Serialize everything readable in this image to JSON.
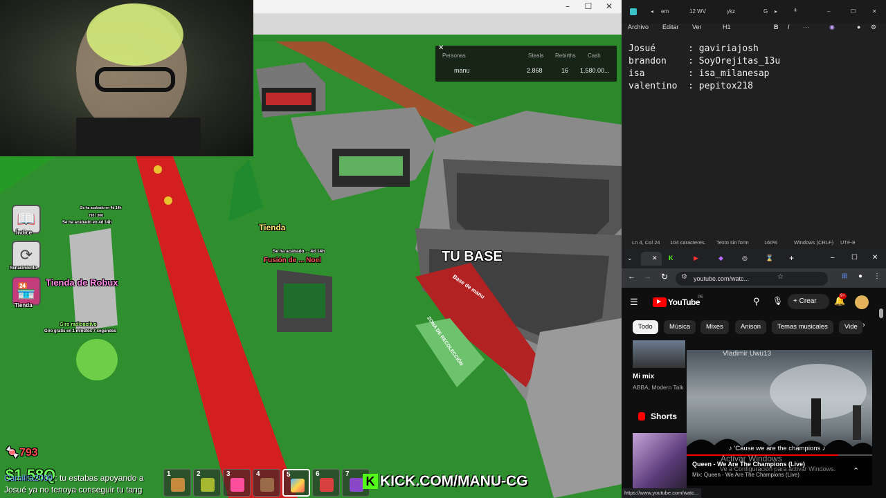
{
  "game": {
    "leaderboard": {
      "headers": [
        "Personas",
        "Steals",
        "Rebirths",
        "Cash"
      ],
      "row": {
        "name": "manu",
        "steals": "2.868",
        "rebirths": "16",
        "cash": "1.580.00..."
      }
    },
    "labels": {
      "tu_base": "TU BASE",
      "base_de_manu": "Base de manu",
      "zona": "ZONA DE RECOLECCIÓN",
      "tienda": "Tienda",
      "fusion": "Fusión de ... Noel",
      "se_ha_acabado_1": "Se ha acabado en 4d 14h",
      "se_ha_acabado_2": "Se ha acabado en 4d 14h",
      "se_ha_acabado_3": "Se ha acabado ... 4d 14h",
      "counter_small": "793 / 300",
      "tienda_robux": "Tienda de Robux",
      "giro": "Giro radioactivo",
      "giro_sub": "Giro gratis en 1 minutos 7 segundos",
      "candy_count": "793",
      "cash_partial": "$1.58Q",
      "kick": "KICK.COM/MANU-CG"
    },
    "side_buttons": [
      {
        "label": "Índice",
        "icon": "book-icon"
      },
      {
        "label": "Renacimiento",
        "icon": "refresh-icon"
      },
      {
        "label": "Tienda",
        "icon": "shop-icon"
      }
    ],
    "hotbar": [
      "1",
      "2",
      "3",
      "4",
      "5",
      "6",
      "7"
    ],
    "chat": [
      {
        "user": "Camilita2009",
        "text": ": tu estabas apoyando a"
      },
      {
        "user": "",
        "text": "Josué ya no tenoya conseguir tu tang"
      }
    ],
    "window_controls": [
      "–",
      "☐",
      "✕"
    ]
  },
  "editor": {
    "tabs": [
      "em",
      "12 WV",
      "ykz",
      "G"
    ],
    "menu": [
      "Archivo",
      "Editar",
      "Ver",
      "H1"
    ],
    "content": "Josué      : gaviriajosh\nbrandon    : SoyOrejitas_13u\nisa        : isa_milanesap\nvalentino  : pepitox218",
    "status": [
      "Ln 4, Col 24",
      "104 caracteres.",
      "Texto sin form",
      "160%",
      "Windows (CRLF)",
      "UTF-8"
    ]
  },
  "browser": {
    "url": "youtube.com/watc...",
    "yt_logo": "YouTube",
    "yt_region": "PE",
    "create": "Crear",
    "notif_count": "9+",
    "chips": [
      "Todo",
      "Música",
      "Mixes",
      "Anison",
      "Temas musicales",
      "Vide"
    ],
    "mix_title": "Mi mix",
    "mix_sub": "ABBA, Modern Talk",
    "shorts": "Shorts",
    "mini_title_top": "Vladimir Uwu13",
    "caption": "♪ 'Cause we are the champions ♪",
    "activate": "Activar Windows",
    "activate_sub": "Ve a Configuración para activar Windows.",
    "now_title": "Queen - We Are The Champions (Live)",
    "now_sub": "Mix: Queen - We Are The Champions (Live)",
    "status_url": "https://www.youtube.com/watc..."
  }
}
